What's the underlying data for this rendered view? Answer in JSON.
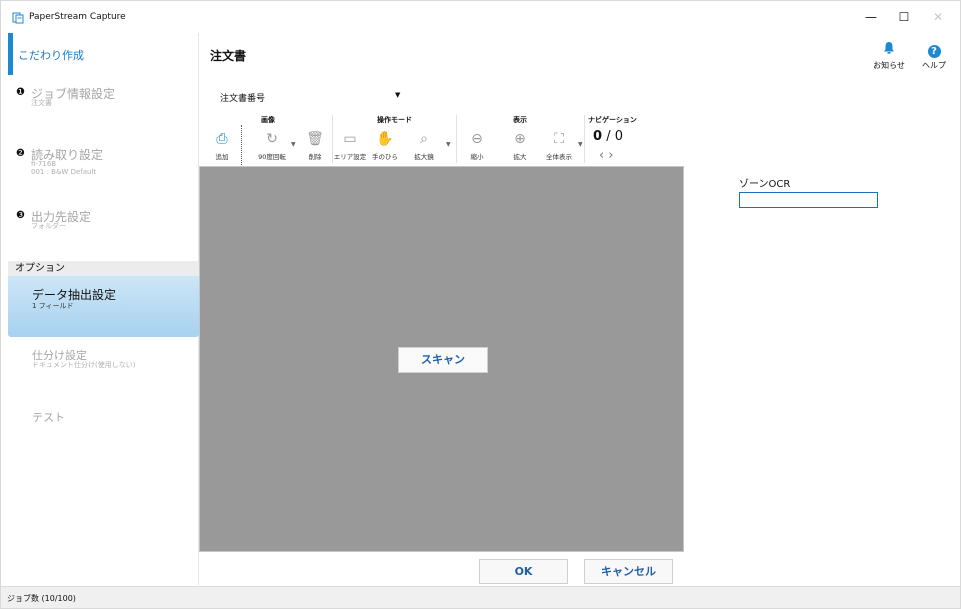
{
  "window": {
    "title": "PaperStream Capture",
    "controls": {
      "minimize": "—",
      "maximize": "☐",
      "close": "✕"
    }
  },
  "sidebar": {
    "header": "こだわり作成",
    "steps": [
      {
        "num": "❶",
        "title": "ジョブ情報設定",
        "sub1": "注文書",
        "sub2": ""
      },
      {
        "num": "❷",
        "title": "読み取り設定",
        "sub1": "fi-716B",
        "sub2": "001 : B&W Default"
      },
      {
        "num": "❸",
        "title": "出力先設定",
        "sub1": "フォルダー",
        "sub2": ""
      }
    ],
    "options_header": "オプション",
    "options": [
      {
        "title": "データ抽出設定",
        "sub": "1 フィールド"
      },
      {
        "title": "仕分け設定",
        "sub": "ドキュメント仕分け(使用しない)"
      },
      {
        "title": "テスト",
        "sub": ""
      }
    ]
  },
  "header": {
    "page_title": "注文書",
    "notice_label": "お知らせ",
    "help_label": "ヘルプ",
    "help_glyph": "?"
  },
  "doc_select": {
    "value": "注文書番号"
  },
  "toolbar": {
    "groups": {
      "image": "画像",
      "mode": "操作モード",
      "view": "表示",
      "nav": "ナビゲーション"
    },
    "buttons": {
      "add": "追加",
      "rotate": "90度回転",
      "delete": "削除",
      "area": "エリア設定",
      "hand": "手のひら",
      "zoom_box": "拡大鏡",
      "zoom_out": "縮小",
      "zoom_in": "拡大",
      "fit": "全体表示"
    },
    "nav": {
      "current": "0",
      "separator": "/",
      "total": "0"
    }
  },
  "canvas": {
    "scan_label": "スキャン"
  },
  "right_panel": {
    "zone_label": "ゾーンOCR",
    "zone_value": ""
  },
  "footer": {
    "ok_label": "OK",
    "cancel_label": "キャンセル"
  },
  "status": {
    "text": "ジョブ数 (10/100)"
  },
  "colors": {
    "accent": "#1e88d0",
    "active_item": "#b8dbf3",
    "canvas": "#999999",
    "button_text": "#1f5fa8"
  }
}
